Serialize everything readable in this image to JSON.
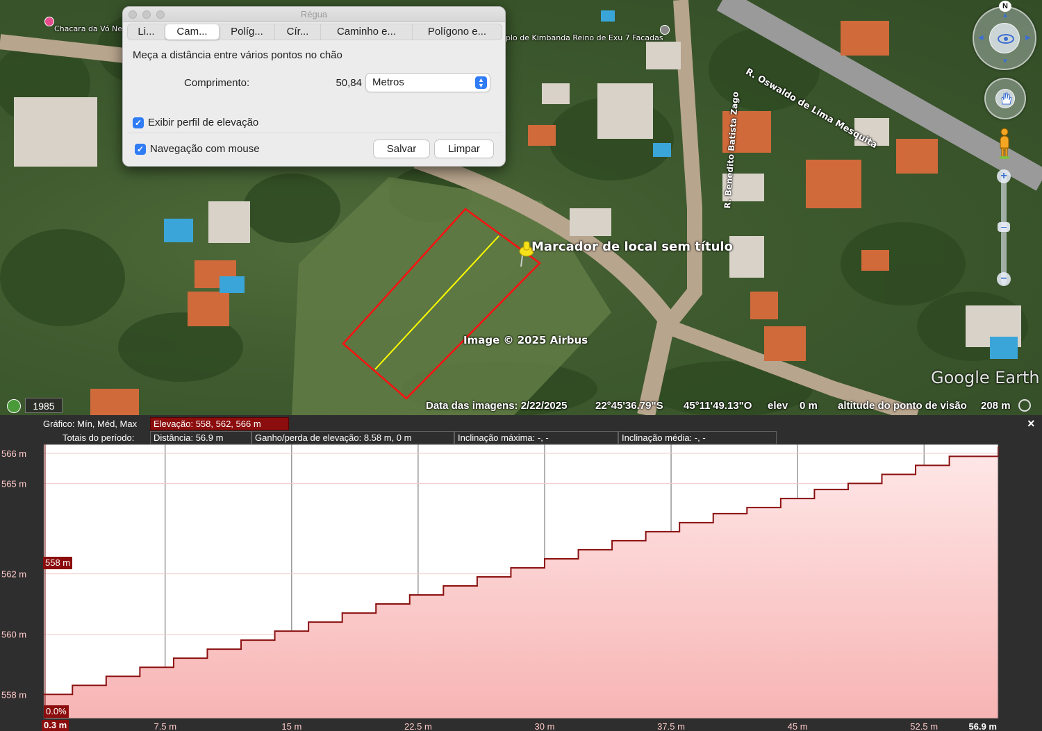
{
  "ruler": {
    "title": "Régua",
    "tabs": [
      {
        "label": "Li..."
      },
      {
        "label": "Cam..."
      },
      {
        "label": "Políg..."
      },
      {
        "label": "Cír..."
      },
      {
        "label": "Caminho e..."
      },
      {
        "label": "Polígono e..."
      }
    ],
    "active_tab": 1,
    "description": "Meça a distância entre vários pontos no chão",
    "length_label": "Comprimento:",
    "length_value": "50,84",
    "unit_selected": "Metros",
    "show_elevation_profile_label": "Exibir perfil de elevação",
    "show_elevation_profile_checked": true,
    "mouse_navigation_label": "Navegação com mouse",
    "mouse_navigation_checked": true,
    "save_label": "Salvar",
    "clear_label": "Limpar"
  },
  "map": {
    "place_labels": {
      "chacara": "Chacara da Vó Ne",
      "kimbanda": "plo de Kimbanda Reino de Exu 7 Facadas"
    },
    "street_labels": {
      "oswaldo": "R. Oswaldo de Lima Mesquita",
      "benedito": "R. Benedito Batista Zago"
    },
    "placemark_label": "Marcador de local sem título",
    "copyright": "Image © 2025 Airbus",
    "brand": "Google Earth",
    "compass_north": "N",
    "historical_year": "1985"
  },
  "status_bar": {
    "imagery_date": "Data das imagens: 2/22/2025",
    "latitude": "22°45'36.79\"S",
    "longitude": "45°11'49.13\"O",
    "elev_label": "elev",
    "elev_value": "0 m",
    "eye_alt_label": "altitude do ponto de visão",
    "eye_alt_value": "208 m"
  },
  "profile": {
    "graph_label": "Gráfico: Mín, Méd, Max",
    "elevation_summary": "Elevação: 558, 562, 566 m",
    "totals_label": "Totais do período:",
    "distance": "Distância: 56.9 m",
    "gain_loss": "Ganho/perda de elevação: 8.58 m, 0 m",
    "max_slope": "Inclinação máxima: -, -",
    "avg_slope": "Inclinação média: -, -",
    "close_icon": "×",
    "cursor_elevation": "558 m",
    "cursor_slope": "0.0%",
    "cursor_distance": "0.3 m"
  },
  "chart_data": {
    "type": "area",
    "x": [
      0.3,
      2,
      4,
      6,
      8,
      10,
      12,
      14,
      16,
      18,
      20,
      22,
      24,
      26,
      28,
      30,
      32,
      34,
      36,
      38,
      40,
      42,
      44,
      46,
      48,
      50,
      52,
      54,
      56.9
    ],
    "y": [
      558.0,
      558.3,
      558.6,
      558.9,
      559.2,
      559.5,
      559.8,
      560.1,
      560.4,
      560.7,
      561.0,
      561.3,
      561.6,
      561.9,
      562.2,
      562.5,
      562.8,
      563.1,
      563.4,
      563.7,
      564.0,
      564.2,
      564.5,
      564.8,
      565.0,
      565.3,
      565.6,
      565.9,
      566.2
    ],
    "x_ticks": [
      "0.3 m",
      "7.5 m",
      "15 m",
      "22.5 m",
      "30 m",
      "37.5 m",
      "45 m",
      "52.5 m",
      "56.9 m"
    ],
    "x_tick_values": [
      0.3,
      7.5,
      15,
      22.5,
      30,
      37.5,
      45,
      52.5,
      56.9
    ],
    "y_ticks": [
      "566 m",
      "565 m",
      "562 m",
      "560 m",
      "558 m"
    ],
    "y_tick_values": [
      566,
      565,
      562,
      560,
      558
    ],
    "xlim": [
      0.3,
      56.9
    ],
    "ylim": [
      557.2,
      566.3
    ],
    "grid": true,
    "colors": {
      "line": "#8b1010",
      "fill_top": "#ffe8e8",
      "fill_bottom": "#f7b4b4"
    }
  }
}
